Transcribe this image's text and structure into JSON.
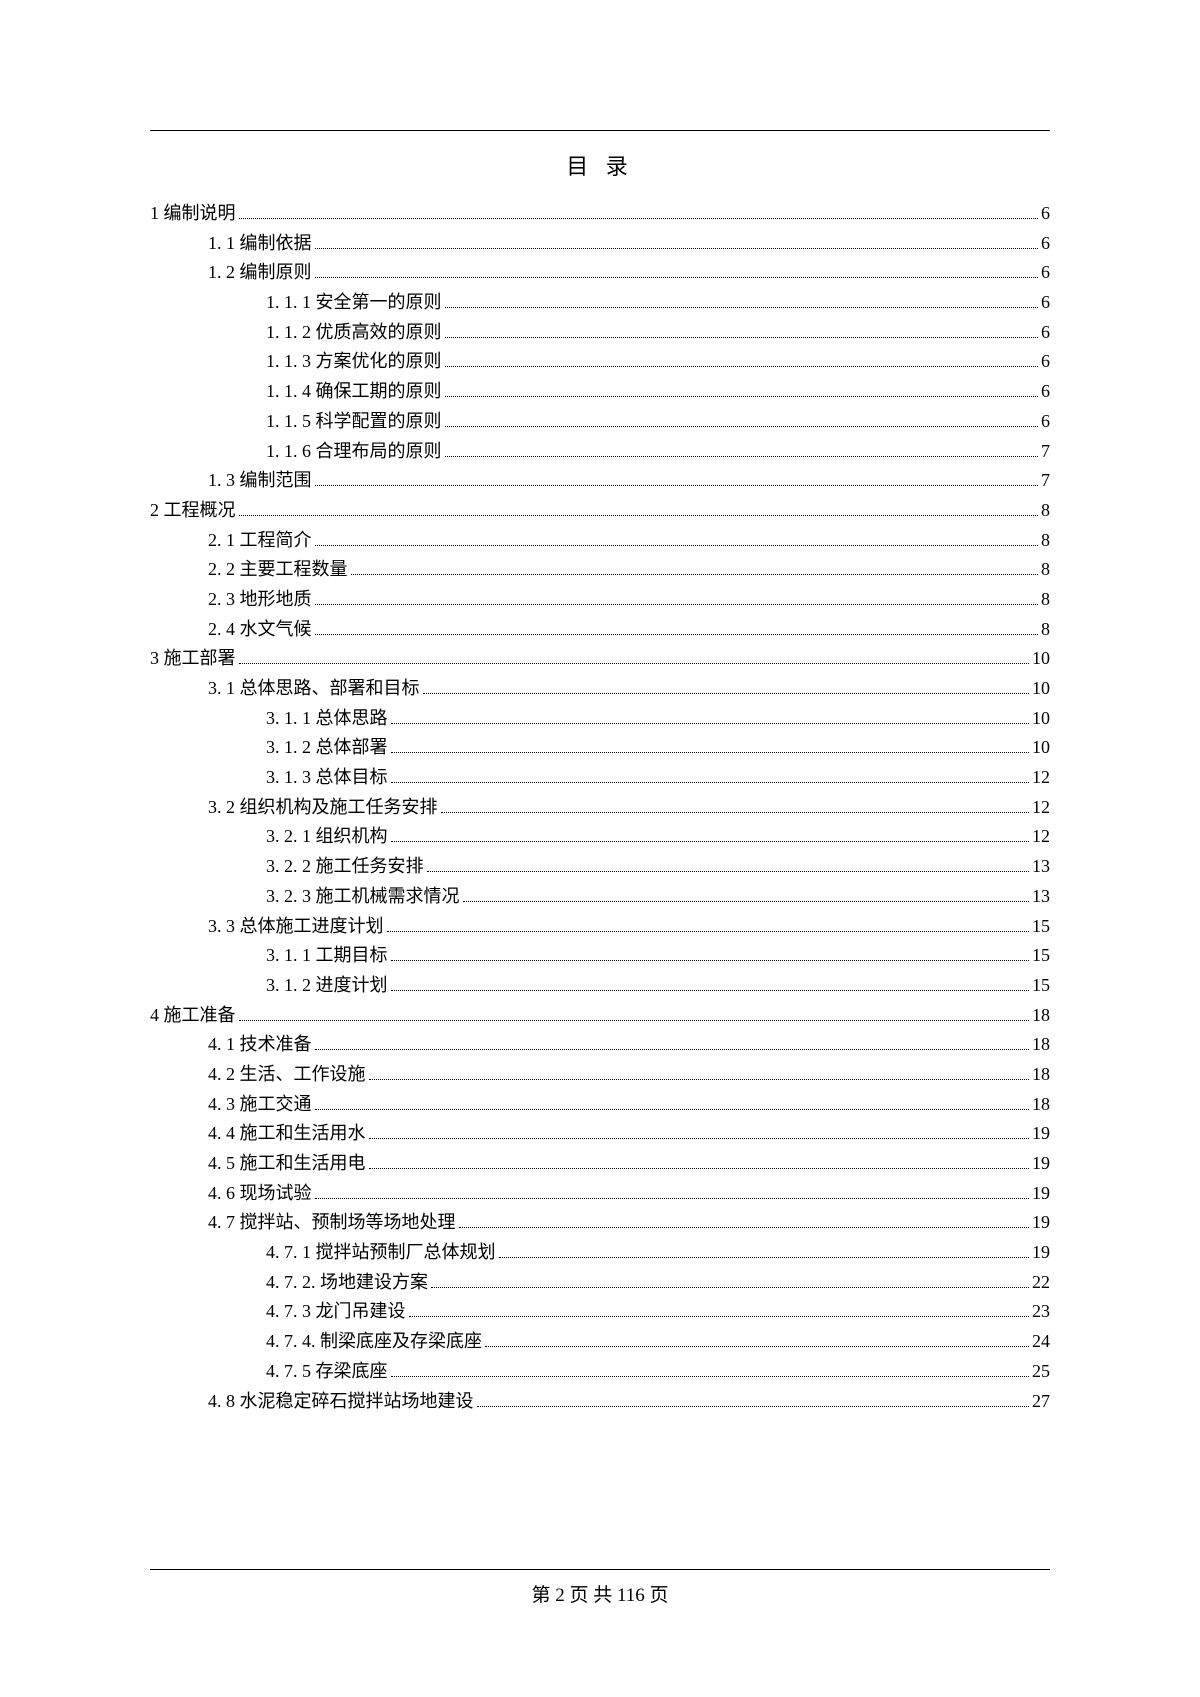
{
  "toc_title": "目 录",
  "entries": [
    {
      "indent": 0,
      "label": "1 编制说明",
      "page": "6"
    },
    {
      "indent": 1,
      "label": "1. 1 编制依据",
      "page": "6"
    },
    {
      "indent": 1,
      "label": "1. 2 编制原则",
      "page": "6"
    },
    {
      "indent": 2,
      "label": "1. 1. 1 安全第一的原则",
      "page": "6"
    },
    {
      "indent": 2,
      "label": "1. 1. 2 优质高效的原则",
      "page": "6"
    },
    {
      "indent": 2,
      "label": "1. 1. 3 方案优化的原则",
      "page": "6"
    },
    {
      "indent": 2,
      "label": "1. 1. 4 确保工期的原则",
      "page": "6"
    },
    {
      "indent": 2,
      "label": "1. 1. 5 科学配置的原则",
      "page": "6"
    },
    {
      "indent": 2,
      "label": "1. 1. 6 合理布局的原则",
      "page": "7"
    },
    {
      "indent": 1,
      "label": "1. 3 编制范围",
      "page": "7"
    },
    {
      "indent": 0,
      "label": "2 工程概况",
      "page": "8"
    },
    {
      "indent": 1,
      "label": "2. 1 工程简介",
      "page": "8"
    },
    {
      "indent": 1,
      "label": "2. 2 主要工程数量",
      "page": "8"
    },
    {
      "indent": 1,
      "label": "2. 3 地形地质",
      "page": "8"
    },
    {
      "indent": 1,
      "label": "2. 4 水文气候",
      "page": "8"
    },
    {
      "indent": 0,
      "label": "3 施工部署",
      "page": "10"
    },
    {
      "indent": 1,
      "label": "3. 1 总体思路、部署和目标",
      "page": "10"
    },
    {
      "indent": 2,
      "label": "3. 1. 1 总体思路",
      "page": "10"
    },
    {
      "indent": 2,
      "label": "3. 1. 2 总体部署",
      "page": "10"
    },
    {
      "indent": 2,
      "label": "3. 1. 3 总体目标",
      "page": "12"
    },
    {
      "indent": 1,
      "label": "3. 2 组织机构及施工任务安排",
      "page": "12"
    },
    {
      "indent": 2,
      "label": "3. 2. 1 组织机构",
      "page": "12"
    },
    {
      "indent": 2,
      "label": "3. 2. 2 施工任务安排",
      "page": "13"
    },
    {
      "indent": 2,
      "label": "3. 2. 3 施工机械需求情况",
      "page": "13"
    },
    {
      "indent": 1,
      "label": "3. 3 总体施工进度计划",
      "page": "15"
    },
    {
      "indent": 2,
      "label": "3. 1. 1 工期目标",
      "page": "15"
    },
    {
      "indent": 2,
      "label": "3. 1. 2 进度计划",
      "page": "15"
    },
    {
      "indent": 0,
      "label": "4 施工准备",
      "page": "18"
    },
    {
      "indent": 1,
      "label": "4. 1 技术准备",
      "page": "18"
    },
    {
      "indent": 1,
      "label": "4. 2 生活、工作设施",
      "page": "18"
    },
    {
      "indent": 1,
      "label": "4. 3 施工交通",
      "page": "18"
    },
    {
      "indent": 1,
      "label": "4. 4 施工和生活用水",
      "page": "19"
    },
    {
      "indent": 1,
      "label": "4. 5 施工和生活用电",
      "page": "19"
    },
    {
      "indent": 1,
      "label": "4. 6 现场试验",
      "page": "19"
    },
    {
      "indent": 1,
      "label": "4. 7 搅拌站、预制场等场地处理",
      "page": "19"
    },
    {
      "indent": 2,
      "label": "4. 7. 1 搅拌站预制厂总体规划",
      "page": "19"
    },
    {
      "indent": 2,
      "label": "4. 7. 2. 场地建设方案",
      "page": "22"
    },
    {
      "indent": 2,
      "label": "4. 7. 3 龙门吊建设",
      "page": "23"
    },
    {
      "indent": 2,
      "label": "4. 7. 4. 制梁底座及存梁底座",
      "page": "24"
    },
    {
      "indent": 2,
      "label": "4. 7. 5 存梁底座",
      "page": "25"
    },
    {
      "indent": 1,
      "label": "4. 8 水泥稳定碎石搅拌站场地建设",
      "page": "27"
    }
  ],
  "footer_text": "第 2 页 共 116 页"
}
